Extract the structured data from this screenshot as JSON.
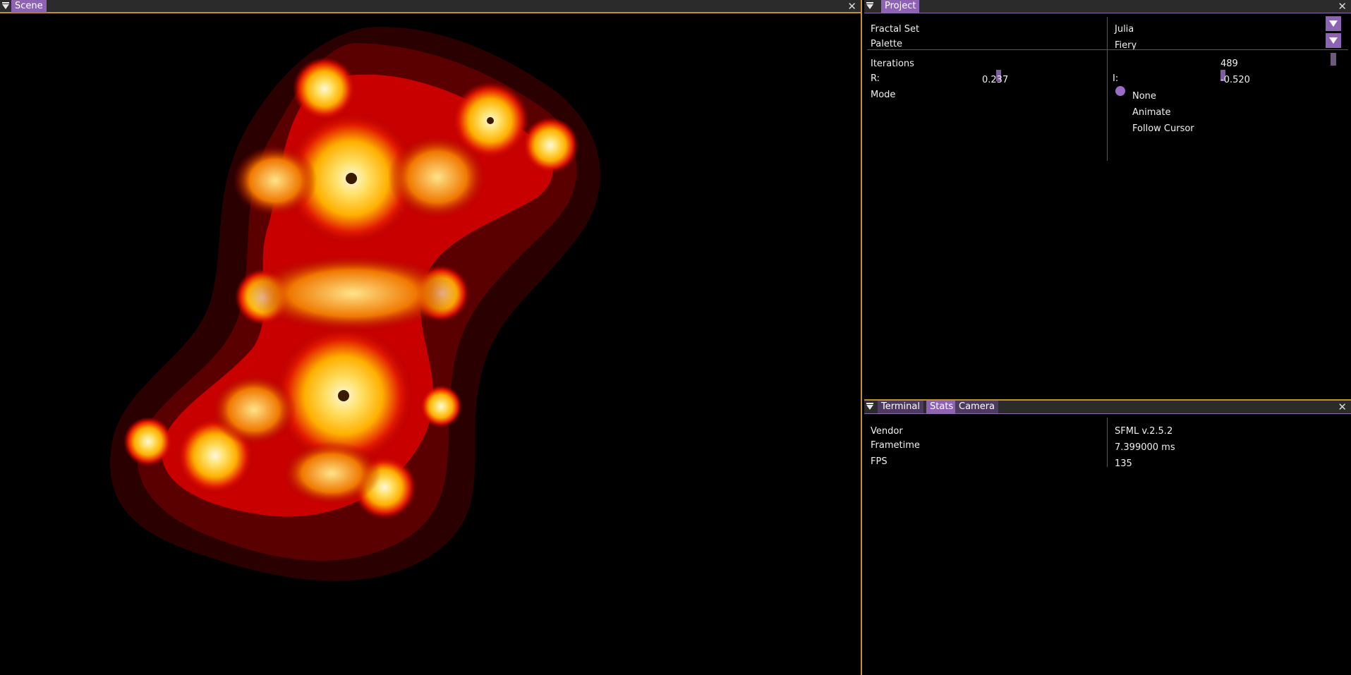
{
  "scene": {
    "title": "Scene",
    "close_icon": "close-icon",
    "colors": {
      "background": "#000000",
      "glow_outer": "#3a0000",
      "red": "#d40000",
      "orange": "#ff9a00",
      "yellow": "#ffd400",
      "white": "#fff6c8"
    }
  },
  "project": {
    "title": "Project",
    "fractal_set_label": "Fractal Set",
    "fractal_set_value": "Julia",
    "palette_label": "Palette",
    "palette_value": "Fiery",
    "iterations_label": "Iterations",
    "iterations_value": "489",
    "r_label": "R:",
    "r_value": "0.237",
    "i_label": "I:",
    "i_value": "-0.520",
    "mode_label": "Mode",
    "mode_options": [
      "None",
      "Animate",
      "Follow Cursor"
    ],
    "mode_selected": "None"
  },
  "bottom_panel": {
    "tabs": [
      "Terminal",
      "Stats",
      "Camera"
    ],
    "active_tab": "Stats",
    "stats": [
      {
        "label": "Vendor",
        "value": "SFML v.2.5.2"
      },
      {
        "label": "Frametime",
        "value": "7.399000 ms"
      },
      {
        "label": "FPS",
        "value": "135"
      }
    ]
  },
  "accent_colors": {
    "purple": "#8e63b4",
    "gold": "#c98d2a"
  }
}
